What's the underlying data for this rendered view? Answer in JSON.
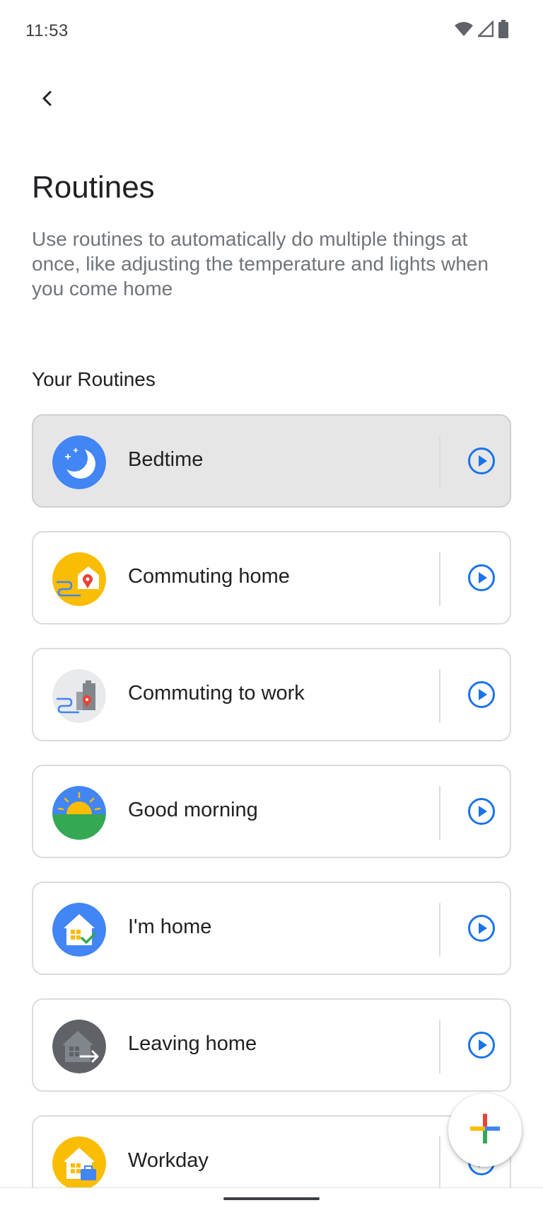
{
  "status_bar": {
    "time": "11:53",
    "icons": [
      "wifi-icon",
      "cell-signal-icon",
      "battery-icon"
    ]
  },
  "header": {
    "back_icon": "chevron-left-icon",
    "title": "Routines",
    "description": "Use routines to automatically do multiple things at once, like adjusting the temperature and lights when you come home"
  },
  "section": {
    "title": "Your Routines"
  },
  "routines": [
    {
      "name": "Bedtime",
      "icon": "moon-icon",
      "selected": true
    },
    {
      "name": "Commuting home",
      "icon": "commute-home-icon"
    },
    {
      "name": "Commuting to work",
      "icon": "commute-work-icon"
    },
    {
      "name": "Good morning",
      "icon": "sunrise-icon"
    },
    {
      "name": "I'm home",
      "icon": "house-check-icon"
    },
    {
      "name": "Leaving home",
      "icon": "house-arrow-icon"
    },
    {
      "name": "Workday",
      "icon": "house-briefcase-icon"
    }
  ],
  "fab": {
    "icon": "plus-icon"
  },
  "colors": {
    "accent_blue": "#4285f4",
    "google_red": "#ea4335",
    "google_yellow": "#fbbc04",
    "google_green": "#34a853",
    "play_blue": "#1a73e8"
  }
}
